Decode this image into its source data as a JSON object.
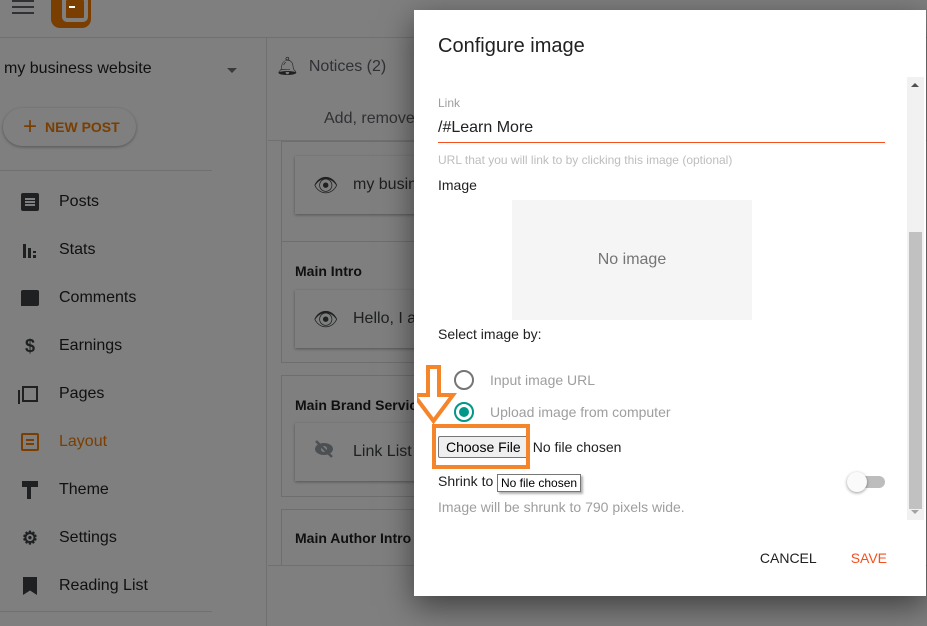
{
  "app": {
    "blog_name": "my business website",
    "new_post_label": "NEW POST",
    "nav": [
      {
        "label": "Posts",
        "icon": "posts-icon",
        "active": false
      },
      {
        "label": "Stats",
        "icon": "stats-icon",
        "active": false
      },
      {
        "label": "Comments",
        "icon": "comments-icon",
        "active": false
      },
      {
        "label": "Earnings",
        "icon": "earnings-icon",
        "active": false
      },
      {
        "label": "Pages",
        "icon": "pages-icon",
        "active": false
      },
      {
        "label": "Layout",
        "icon": "layout-icon",
        "active": true
      },
      {
        "label": "Theme",
        "icon": "theme-icon",
        "active": false
      },
      {
        "label": "Settings",
        "icon": "settings-icon",
        "active": false
      },
      {
        "label": "Reading List",
        "icon": "reading-list-icon",
        "active": false
      }
    ],
    "accent_color": "#f57d00"
  },
  "content": {
    "notices": "Notices (2)",
    "add_remove": "Add, remove",
    "sections": [
      {
        "title": "",
        "gadget": "my busin",
        "visible": true
      },
      {
        "title": "Main Intro",
        "gadget": "Hello, I a",
        "visible": true
      },
      {
        "title": "Main Brand Service",
        "gadget": "Link List",
        "visible": false
      },
      {
        "title": "Main Author Intro H",
        "gadget": "",
        "visible": true
      }
    ]
  },
  "dialog": {
    "title": "Configure image",
    "link_label": "Link",
    "link_value": "/#Learn More",
    "link_helper": "URL that you will link to by clicking this image (optional)",
    "image_label": "Image",
    "no_image": "No image",
    "select_by_label": "Select image by:",
    "radio_options": [
      {
        "label": "Input image URL",
        "checked": false
      },
      {
        "label": "Upload image from computer",
        "checked": true
      }
    ],
    "choose_file_label": "Choose File",
    "file_status": "No file chosen",
    "tooltip": "No file chosen",
    "shrink_label": "Shrink to",
    "shrink_enabled": false,
    "shrink_help": "Image will be shrunk to 790 pixels wide.",
    "cancel_label": "CANCEL",
    "save_label": "SAVE",
    "accent_color": "#f4511e",
    "radio_color": "#009688"
  },
  "annotation": {
    "highlight_color": "#f5852a"
  }
}
